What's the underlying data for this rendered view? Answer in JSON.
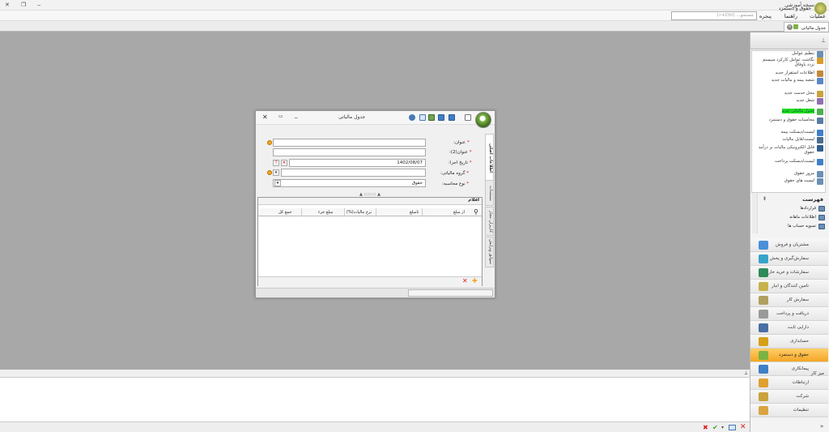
{
  "window": {
    "title": "نسخه آموزشی",
    "close_glyph": "✕",
    "restore_glyph": "❐",
    "minimize_glyph": "‒"
  },
  "menu": {
    "items": [
      "عملیات",
      "راهنما",
      "پنجره"
    ],
    "search_placeholder": "جستجو... (Ctrl+«)"
  },
  "doc_tab": {
    "label": "جدول مالیاتی"
  },
  "nav": {
    "header_title": "حقوق و دستمزد",
    "items": [
      {
        "label": "تنظیم عوامل",
        "icon": "settings-icon",
        "color": "#6b8fb5"
      },
      {
        "label": "نگاشت عوامل کارکرد سیستم تردد باوفاق",
        "icon": "map-icon",
        "color": "#d99a2b"
      },
      {
        "label": "اطلاعات استقرار جدید",
        "icon": "user-icon",
        "color": "#c4883a"
      },
      {
        "label": "شعبه بیمه و مالیات جدید",
        "icon": "building-icon",
        "color": "#5a86c5"
      },
      {
        "label": "محل خدمت جدید",
        "icon": "location-icon",
        "color": "#c9a23c"
      },
      {
        "label": "شغل جدید",
        "icon": "job-icon",
        "color": "#8f6fb1"
      },
      {
        "label": "جدول مالیاتی جدید",
        "icon": "table-icon",
        "color": "#4caf50"
      },
      {
        "label": "محاسبات حقوق و دستمزد",
        "icon": "calc-icon",
        "color": "#5a7ca3"
      },
      {
        "label": "لیست/دیسکت بیمه",
        "icon": "disk-icon",
        "color": "#3f7fc8"
      },
      {
        "label": "لیست/فایل مالیات",
        "icon": "file-icon",
        "color": "#4a6b8f"
      },
      {
        "label": "فایل الکترونیکی مالیات بر درآمد حقوق",
        "icon": "efile-icon",
        "color": "#2f5f8f"
      },
      {
        "label": "لیست/دیسکت پرداخت",
        "icon": "payment-disk-icon",
        "color": "#3f7fc8"
      },
      {
        "label": "مرور حقوق",
        "icon": "review-icon",
        "color": "#6b8fb5"
      },
      {
        "label": "لیست های حقوق",
        "icon": "list-icon",
        "color": "#6b8fb5"
      }
    ],
    "active_index": 6,
    "favorites_title": "فهرست",
    "favorites": [
      {
        "label": "قراردادها",
        "icon": "contract-icon"
      },
      {
        "label": "اطلاعات ماهانه",
        "icon": "monthly-icon"
      },
      {
        "label": "تسویه حساب ها",
        "icon": "settlement-icon"
      }
    ],
    "modules": [
      {
        "label": "مشتریان و فروش",
        "color": "#4a90d9"
      },
      {
        "label": "سفارش‌گیری و پخش",
        "color": "#38a3c9"
      },
      {
        "label": "سفارشات و خرید خارجی",
        "color": "#2e8b57"
      },
      {
        "label": "تامین کنندگان و انبار",
        "color": "#c7b24a"
      },
      {
        "label": "سفارش کار",
        "color": "#b0a060"
      },
      {
        "label": "دریافت و پرداخت",
        "color": "#9a9a9a"
      },
      {
        "label": "دارایی ثابت",
        "color": "#4a6fa5"
      },
      {
        "label": "حسابداری",
        "color": "#d4a017"
      },
      {
        "label": "حقوق و دستمزد",
        "color": "#7cb342"
      },
      {
        "label": "پیمانکاری",
        "color": "#3f7fc8"
      },
      {
        "label": "ارتباطات",
        "color": "#e0a030"
      },
      {
        "label": "شرکت",
        "color": "#c9a23c"
      },
      {
        "label": "تنظیمات",
        "color": "#d9a441"
      }
    ],
    "active_module_index": 8
  },
  "bottom_panel": {
    "title": "میز کار"
  },
  "dialog": {
    "title": "جدول مالیاتی",
    "close_glyph": "✕",
    "maximize_glyph": "▭",
    "minimize_glyph": "_",
    "side_tabs": [
      "اطلاعات اصلی",
      "مستندات",
      "کاربران مجاز",
      "سوابق ویرایش"
    ],
    "fields": {
      "title_label": "عنوان",
      "title2_label": "عنوان(2)",
      "date_label": "تاریخ اجرا",
      "date_value": "1402/08/07",
      "group_label": "گروه مالیاتی",
      "calc_type_label": "نوع محاسبه",
      "calc_type_value": "حقوق"
    },
    "splitter_glyph": "▲ ::::::::: ▲",
    "grid": {
      "caption": "اقلام",
      "columns": [
        "از مبلغ",
        "تامبلغ",
        "نرخ مالیات(%)",
        "مبلغ جزء",
        "جمع کل"
      ]
    }
  }
}
